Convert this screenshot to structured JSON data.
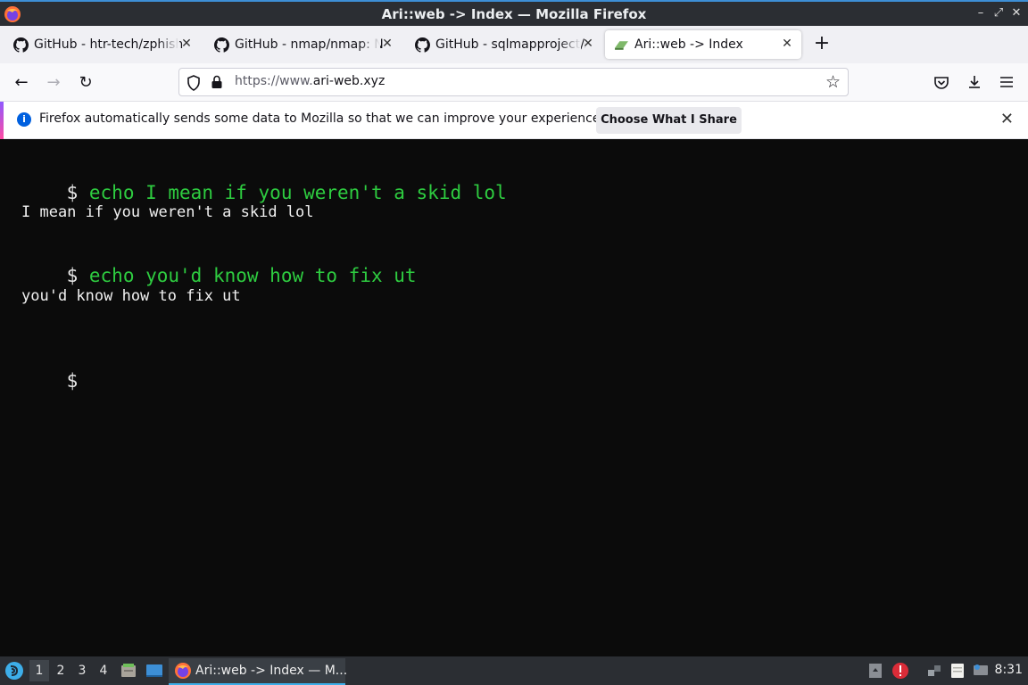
{
  "window": {
    "title": "Ari::web -> Index — Mozilla Firefox",
    "controls": {
      "minimize": "–",
      "maximize": "⤢",
      "close": "✕"
    }
  },
  "tabs": [
    {
      "label": "GitHub - htr-tech/zphisher",
      "icon": "github-icon",
      "active": false
    },
    {
      "label": "GitHub - nmap/nmap: Nmap",
      "icon": "github-icon",
      "active": false
    },
    {
      "label": "GitHub - sqlmapproject/sqlmap",
      "icon": "github-icon",
      "active": false
    },
    {
      "label": "Ari::web -> Index",
      "icon": "site-favicon",
      "active": true
    }
  ],
  "tab_close": "✕",
  "new_tab": "+",
  "nav": {
    "back": "←",
    "forward": "→",
    "reload": "↻",
    "url_prefix": "https://www.",
    "url_host": "ari-web.xyz",
    "bookmark": "☆"
  },
  "notification": {
    "message": "Firefox automatically sends some data to Mozilla so that we can improve your experience.",
    "button": "Choose What I Share",
    "close": "✕",
    "info_glyph": "i"
  },
  "terminal": {
    "lines": [
      {
        "type": "prompt",
        "dollar": "$",
        "command": "echo I mean if you weren't a skid lol"
      },
      {
        "type": "output",
        "text": "I mean if you weren't a skid lol"
      },
      {
        "type": "prompt",
        "dollar": "$",
        "command": "echo you'd know how to fix ut"
      },
      {
        "type": "output",
        "text": "you'd know how to fix ut"
      },
      {
        "type": "prompt",
        "dollar": "$",
        "command": ""
      }
    ]
  },
  "taskbar": {
    "workspaces": [
      "1",
      "2",
      "3",
      "4"
    ],
    "active_workspace": "1",
    "task_label": "Ari::web -> Index — M...",
    "clock": "8:31"
  },
  "colors": {
    "terminal_bg": "#0b0b0b",
    "command_green": "#2ecc40",
    "accent_blue": "#3daee9"
  }
}
